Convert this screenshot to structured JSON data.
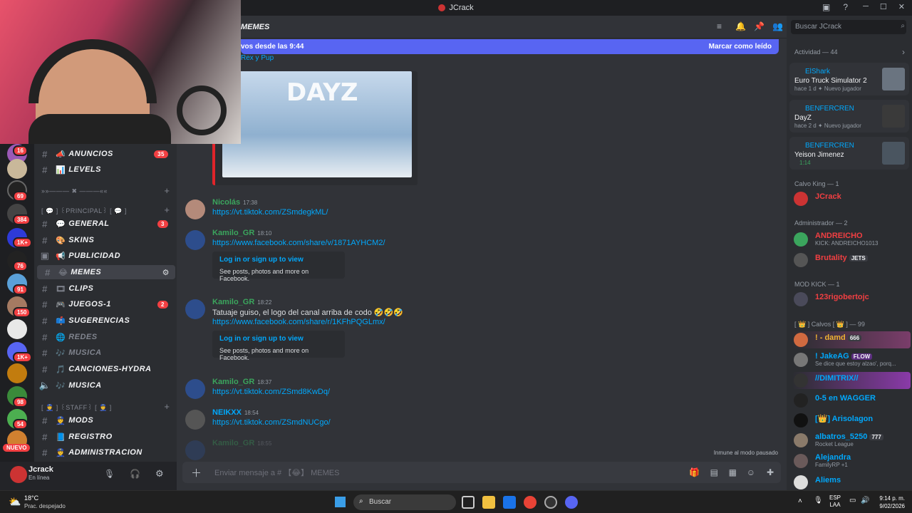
{
  "window": {
    "title": "JCrack"
  },
  "channel_header": {
    "name": "MEMES"
  },
  "banner": {
    "text": "vos desde las 9:44",
    "mark_read": "Marcar como leído"
  },
  "first_msg_tail": "Rex y Pup",
  "guild_badges": [
    "16",
    "69",
    "384",
    "1K+",
    "76",
    "91",
    "150",
    "1K+",
    "98",
    "54"
  ],
  "nuevo_label": "NUEVO",
  "channels": [
    {
      "icon": "📣",
      "label": "ANUNCIOS",
      "badge": "35"
    },
    {
      "icon": "📊",
      "label": "LEVELS",
      "badge": ""
    },
    {
      "icon": "💬",
      "label": "GENERAL",
      "badge": "3"
    },
    {
      "icon": "🎨",
      "label": "SKINS",
      "badge": ""
    },
    {
      "icon": "📢",
      "label": "PUBLICIDAD",
      "badge": ""
    },
    {
      "icon": "😂",
      "label": "MEMES",
      "badge": ""
    },
    {
      "icon": "🎞",
      "label": "CLIPS",
      "badge": ""
    },
    {
      "icon": "🎮",
      "label": "JUEGOS-1",
      "badge": "2"
    },
    {
      "icon": "📫",
      "label": "SUGERENCIAS",
      "badge": ""
    },
    {
      "icon": "🌐",
      "label": "REDES",
      "badge": ""
    },
    {
      "icon": "🎶",
      "label": "MUSICA",
      "badge": ""
    },
    {
      "icon": "🎵",
      "label": "CANCIONES-HYDRA",
      "badge": ""
    },
    {
      "icon": "🎶",
      "label": "MUSICA",
      "badge": ""
    },
    {
      "icon": "👮",
      "label": "MODS",
      "badge": ""
    },
    {
      "icon": "📘",
      "label": "REGISTRO",
      "badge": ""
    },
    {
      "icon": "👮",
      "label": "ADMINISTRACION",
      "badge": ""
    }
  ],
  "categories": {
    "divider": "»»———  ✖  ———««",
    "principal": "[ 💬 ] ꒰PRINCIPAL꒱ [ 💬 ]",
    "staff": "[ 👮 ] ꒰STAFF꒱ [ 👮 ]"
  },
  "user": {
    "name": "Jcrack",
    "status": "En línea"
  },
  "messages": [
    {
      "author": "Nicolás",
      "time": "17:38",
      "link": "https://vt.tiktok.com/ZSmdegkML/",
      "color": "#3ba55d"
    },
    {
      "author": "Kamilo_GR",
      "time": "18:10",
      "link": "https://www.facebook.com/share/v/1871AYHCM2/",
      "embed_title": "Log in or sign up to view",
      "embed_desc": "See posts, photos and more on Facebook.",
      "color": "#3ba55d"
    },
    {
      "author": "Kamilo_GR",
      "time": "18:22",
      "text": "Tatuaje guiso, el logo del canal arriba de codo 🤣🤣🤣",
      "link": "https://www.facebook.com/share/r/1KFhPQGLmx/",
      "embed_title": "Log in or sign up to view",
      "embed_desc": "See posts, photos and more on Facebook.",
      "color": "#3ba55d"
    },
    {
      "author": "Kamilo_GR",
      "time": "18:37",
      "link": "https://vt.tiktok.com/ZSmd8KwDq/",
      "color": "#3ba55d"
    },
    {
      "author": "NEIKXX",
      "time": "18:54",
      "link": "https://vt.tiktok.com/ZSmdNUCgo/",
      "color": "#00a8fc"
    },
    {
      "author": "Kamilo_GR",
      "time": "18:55",
      "color": "#3ba55d"
    }
  ],
  "immune_text": "Inmune al modo pausado",
  "composer": {
    "placeholder": "Enviar mensaje a # 【😂】 MEMES"
  },
  "search": {
    "placeholder": "Buscar JCrack"
  },
  "activity": {
    "header": "Actividad — 44",
    "cards": [
      {
        "user": "ElShark",
        "game": "Euro Truck Simulator 2",
        "meta": "hace 1 d",
        "meta2": "Nuevo jugador"
      },
      {
        "user": "BENFERCREN",
        "game": "DayZ",
        "meta": "hace 2 d",
        "meta2": "Nuevo jugador"
      },
      {
        "user": "BENFERCREN",
        "game": "Yeison Jimenez",
        "meta": "1:14",
        "meta2": ""
      }
    ]
  },
  "member_sections": [
    {
      "title": "Calvo King — 1"
    },
    {
      "title": "Administrador — 2"
    },
    {
      "title": "MOD KICK — 1"
    },
    {
      "title": "[ 👑 ] Calvos [ 👑 ] — 99"
    }
  ],
  "members": [
    {
      "name": "JCrack",
      "status": "",
      "color": "#f23f42"
    },
    {
      "name": "ANDREICHO",
      "status": "KICK: ANDREICHO1013",
      "color": "#f23f42"
    },
    {
      "name": "Brutality",
      "status": "",
      "tag": "JETS",
      "color": "#f23f42"
    },
    {
      "name": "123rigobertojc",
      "status": "",
      "color": "#f23f42"
    },
    {
      "name": "! - damd",
      "status": "",
      "tag": "666",
      "color": "#f0b232"
    },
    {
      "name": "! JakeAG",
      "status": "Se dice que estoy alzao', porq...",
      "tag": "FLOW",
      "color": "#f0b232"
    },
    {
      "name": "//DIMITRIX//",
      "status": "",
      "color": "#f0b232"
    },
    {
      "name": "0-5 en WAGGER",
      "status": "",
      "color": "#f0b232"
    },
    {
      "name": "[👑] Arisolagon",
      "status": "",
      "color": "#f0b232"
    },
    {
      "name": "albatros_5250",
      "status": "Rocket League",
      "tag": "777",
      "color": "#f0b232"
    },
    {
      "name": "Alejandra",
      "status": "FamilyRP +1",
      "color": "#f0b232"
    },
    {
      "name": "Aliems",
      "status": "",
      "color": "#f0b232"
    }
  ],
  "taskbar": {
    "weather_temp": "18°C",
    "weather_desc": "Prac. despejado",
    "search": "Buscar",
    "lang": "ESP",
    "lang2": "LAA",
    "time": "9:14 p. m.",
    "date": "9/02/2026"
  }
}
